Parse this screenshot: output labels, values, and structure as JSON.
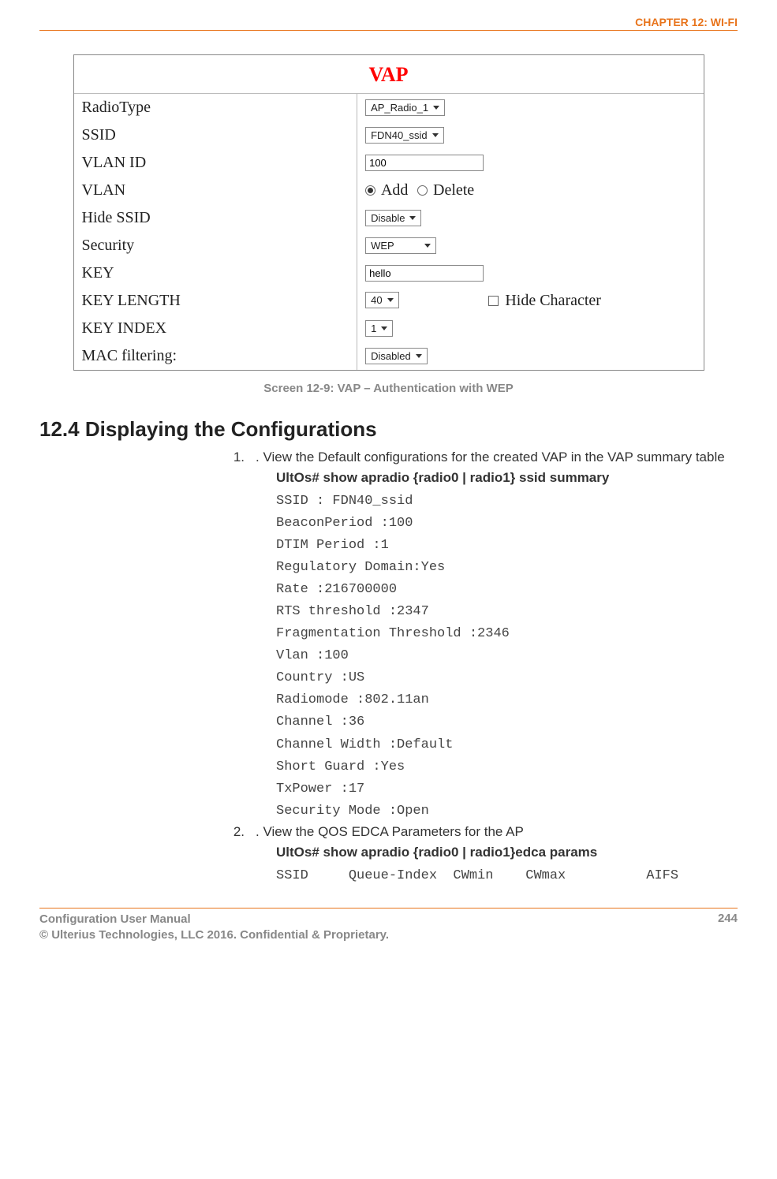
{
  "chapter_header": "CHAPTER 12: WI-FI",
  "vap": {
    "title": "VAP",
    "rows": {
      "radio_type": {
        "label": "RadioType",
        "value": "AP_Radio_1"
      },
      "ssid": {
        "label": "SSID",
        "value": "FDN40_ssid"
      },
      "vlan_id": {
        "label": "VLAN ID",
        "value": "100"
      },
      "vlan": {
        "label": "VLAN",
        "opt_add": "Add",
        "opt_delete": "Delete",
        "selected": "Add"
      },
      "hide_ssid": {
        "label": "Hide SSID",
        "value": "Disable"
      },
      "security": {
        "label": "Security",
        "value": "WEP"
      },
      "key": {
        "label": "KEY",
        "value": "hello"
      },
      "key_length": {
        "label": "KEY LENGTH",
        "value": "40",
        "hide_char_label": "Hide Character"
      },
      "key_index": {
        "label": "KEY INDEX",
        "value": "1"
      },
      "mac_filter": {
        "label": "MAC filtering:",
        "value": "Disabled"
      }
    }
  },
  "caption": "Screen 12-9: VAP – Authentication with WEP",
  "section_heading": "12.4 Displaying the Configurations",
  "list": {
    "item1": {
      "num": "1.",
      "text": ". View the Default configurations for the created VAP in the VAP summary table",
      "cmd": "UltOs# show apradio {radio0 | radio1} ssid summary",
      "output": "SSID : FDN40_ssid\nBeaconPeriod :100\nDTIM Period :1\nRegulatory Domain:Yes\nRate :216700000\nRTS threshold :2347\nFragmentation Threshold :2346\nVlan :100\nCountry :US\nRadiomode :802.11an\nChannel :36\nChannel Width :Default\nShort Guard :Yes\nTxPower :17\nSecurity Mode :Open"
    },
    "item2": {
      "num": "2.",
      "text": ". View the QOS EDCA Parameters for the AP",
      "cmd": "UltOs# show apradio {radio0 | radio1}edca params",
      "output": "SSID     Queue-Index  CWmin    CWmax          AIFS"
    }
  },
  "footer": {
    "line1": "Configuration User Manual",
    "line2": "© Ulterius Technologies, LLC 2016. Confidential & Proprietary.",
    "page": "244"
  }
}
